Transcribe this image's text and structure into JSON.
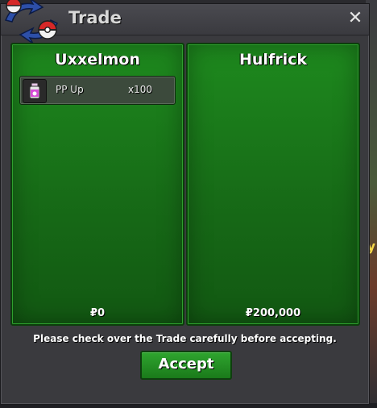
{
  "window": {
    "title": "Trade",
    "close_icon": "close-icon"
  },
  "trade": {
    "left": {
      "name": "Uxxelmon",
      "money": "₽0",
      "items": [
        {
          "icon": "pp-up-potion-icon",
          "name": "PP Up",
          "quantity": "x100"
        }
      ]
    },
    "right": {
      "name": "Hulfrick",
      "money": "₽200,000",
      "items": []
    }
  },
  "notice": "Please check over the Trade carefully before accepting.",
  "accept_label": "Accept",
  "colors": {
    "panel_green": "#1e8a1e",
    "window_bg": "#3a3a3e",
    "accept_green": "#2fa52f"
  }
}
